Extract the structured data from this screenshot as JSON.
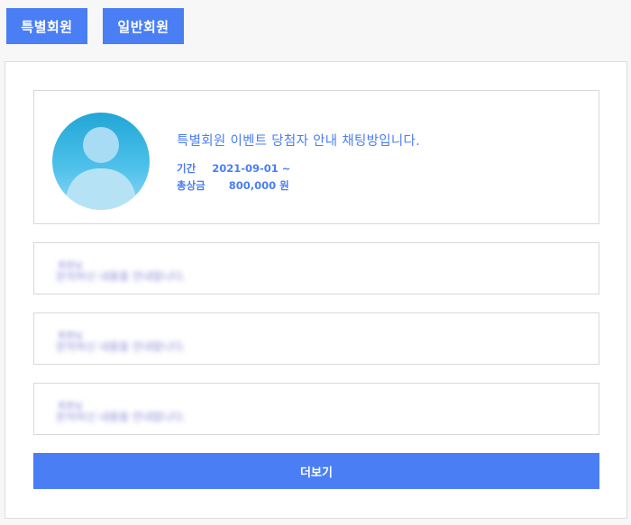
{
  "tabs": [
    {
      "label": "특별회원"
    },
    {
      "label": "일반회원"
    }
  ],
  "event": {
    "title": "특별회원 이벤트 당첨자 안내 채팅방입니다.",
    "period_label": "기간",
    "period_value": "2021-09-01 ~",
    "prize_label": "총상금",
    "prize_value": "800,000 원"
  },
  "messages": [
    {
      "name": "회원님",
      "text": "문의하신 내용을 안내합니다."
    },
    {
      "name": "회원님",
      "text": "문의하신 내용을 안내합니다."
    },
    {
      "name": "회원님",
      "text": "문의하신 내용을 안내합니다."
    }
  ],
  "more_label": "더보기",
  "colors": {
    "accent": "#4a7ef5",
    "border": "#d8d8d8",
    "background": "#f7f7f7",
    "avatar_top": "#22a6d6",
    "avatar_bottom": "#8fd7f4"
  },
  "icons": {
    "avatar": "user-silhouette-icon"
  }
}
